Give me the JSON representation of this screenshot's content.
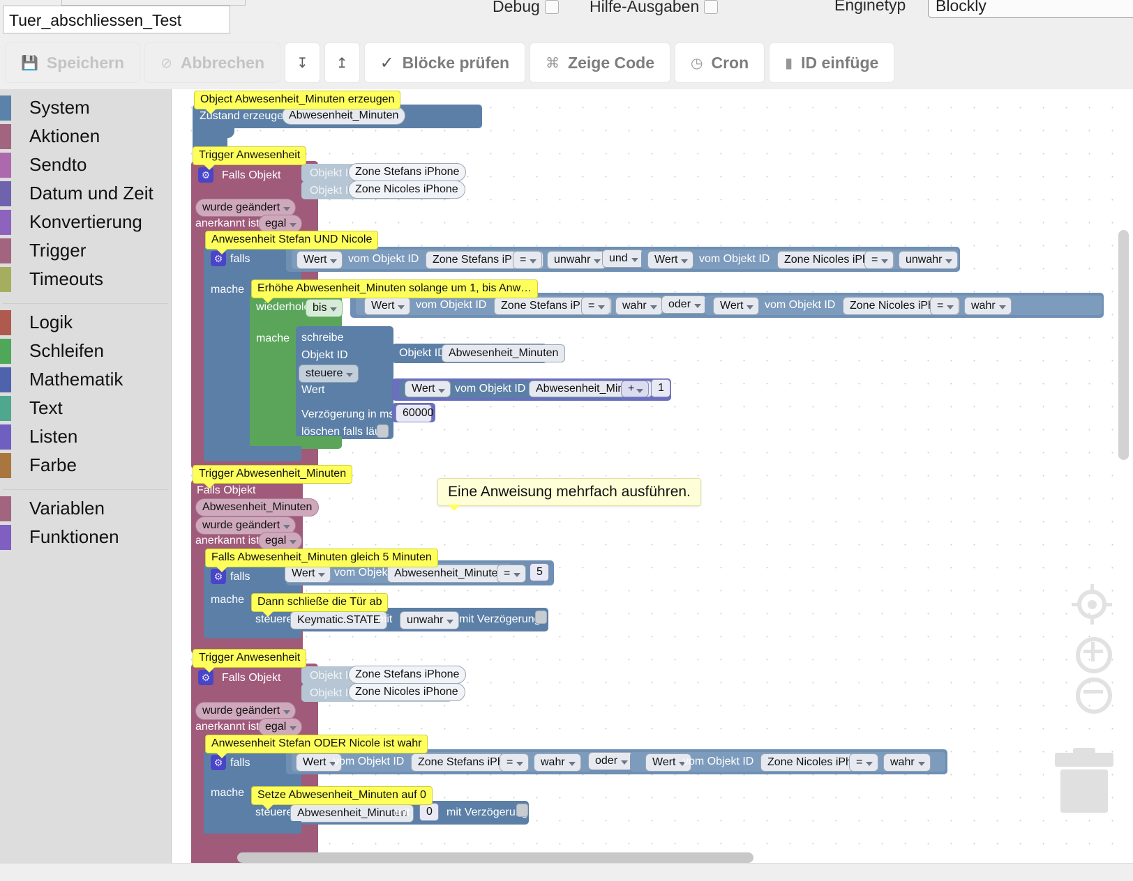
{
  "header": {
    "script_name_value": "Tuer_abschliessen_Test",
    "debug_label": "Debug",
    "hilfe_label": "Hilfe-Ausgaben",
    "enginetyp_label": "Enginetyp",
    "enginetyp_value": "Blockly"
  },
  "toolbar": {
    "save_label": "Speichern",
    "cancel_label": "Abbrechen",
    "import_icon": "download-icon",
    "export_icon": "upload-icon",
    "check_blocks_label": "Blöcke prüfen",
    "show_code_label": "Zeige Code",
    "cron_label": "Cron",
    "insert_id_label": "ID einfüge"
  },
  "sidebar": {
    "groups": [
      {
        "items": [
          {
            "label": "System",
            "color": "#5b82a8"
          },
          {
            "label": "Aktionen",
            "color": "#a2657f"
          },
          {
            "label": "Sendto",
            "color": "#ad69ad"
          },
          {
            "label": "Datum und Zeit",
            "color": "#6f63ad"
          },
          {
            "label": "Konvertierung",
            "color": "#8e63bd"
          },
          {
            "label": "Trigger",
            "color": "#a2657f"
          },
          {
            "label": "Timeouts",
            "color": "#a5ae5f"
          }
        ]
      },
      {
        "items": [
          {
            "label": "Logik",
            "color": "#b05a4f"
          },
          {
            "label": "Schleifen",
            "color": "#4fa85a"
          },
          {
            "label": "Mathematik",
            "color": "#4f63ad"
          },
          {
            "label": "Text",
            "color": "#4fa88e"
          },
          {
            "label": "Listen",
            "color": "#6f5fc0"
          },
          {
            "label": "Farbe",
            "color": "#a9763f"
          }
        ]
      },
      {
        "items": [
          {
            "label": "Variablen",
            "color": "#a2657f"
          },
          {
            "label": "Funktionen",
            "color": "#7f5fc0"
          }
        ]
      }
    ]
  },
  "workspace": {
    "tooltip": "Eine Anweisung mehrfach ausführen.",
    "comments": {
      "create_object": "Object Abwesenheit_Minuten erzeugen",
      "trigger_anwesenheit_1": "Trigger Anwesenheit",
      "and_condition": "Anwesenheit Stefan UND Nicole",
      "increase_loop": "Erhöhe Abwesenheit_Minuten solange um 1, bis Anw…",
      "trigger_minuten": "Trigger Abwesenheit_Minuten",
      "if_equals_five": "Falls Abwesenheit_Minuten gleich 5 Minuten",
      "then_lock": "Dann schließe die Tür ab",
      "trigger_anwesenheit_2": "Trigger Anwesenheit",
      "or_condition": "Anwesenheit Stefan ODER Nicole ist wahr",
      "set_zero": "Setze Abwesenheit_Minuten auf 0"
    },
    "block1": {
      "create_state_label": "Zustand erzeugen",
      "state_name": "Abwesenheit_Minuten"
    },
    "block2": {
      "falls_objekt_label": "Falls Objekt",
      "objekt_id_label": "Objekt ID",
      "object_1": "Zone Stefans iPhone",
      "object_2": "Zone Nicoles iPhone",
      "changed_label": "wurde geändert",
      "ack_label": "anerkannt ist",
      "ack_value": "egal"
    },
    "and_block": {
      "falls_label": "falls",
      "mache_label": "mache",
      "wert_label": "Wert",
      "vom_objekt_id_label": "vom Objekt ID",
      "object_1": "Zone Stefans iPhone",
      "object_2": "Zone Nicoles iPhone",
      "eq_op": "=",
      "val_1": "unwahr",
      "val_2": "unwahr",
      "join_op": "und"
    },
    "loop_block": {
      "wiederhole_label": "wiederhole",
      "bis_label": "bis",
      "mache_label": "mache",
      "wert_label": "Wert",
      "vom_objekt_id_label": "vom Objekt ID",
      "object_1": "Zone Stefans iPhone",
      "object_2": "Zone Nicoles iPhone",
      "eq_op": "=",
      "val_1": "wahr",
      "val_2": "wahr",
      "join_op": "oder"
    },
    "write_block": {
      "schreibe_label": "schreibe",
      "objekt_id_label": "Objekt ID",
      "steuere_label": "steuere",
      "wert_label": "Wert",
      "delay_label": "Verzögerung in ms",
      "clear_label": "löschen falls läuft",
      "obj_id_inner_label": "Objekt ID",
      "obj_id_value": "Abwesenheit_Minuten",
      "wert_inner_label": "Wert",
      "vom_objekt_id_label": "vom Objekt ID",
      "value_object": "Abwesenheit_Minuten",
      "plus_op": "+",
      "addend": "1",
      "delay_value": "60000"
    },
    "trigger_minuten_block": {
      "falls_objekt_label": "Falls Objekt",
      "object_name": "Abwesenheit_Minuten",
      "changed_label": "wurde geändert",
      "ack_label": "anerkannt ist",
      "ack_value": "egal"
    },
    "if_five_block": {
      "falls_label": "falls",
      "mache_label": "mache",
      "wert_label": "Wert",
      "vom_objekt_id_label": "vom Objekt ID",
      "object_name": "Abwesenheit_Minuten",
      "eq_op": "=",
      "number": "5"
    },
    "lock_block": {
      "steuere_label": "steuere",
      "target": "Keymatic.STATE",
      "mit_label": "mit",
      "value": "unwahr",
      "delay_label": "mit Verzögerung"
    },
    "trigger2_block": {
      "falls_objekt_label": "Falls Objekt",
      "objekt_id_label": "Objekt ID",
      "object_1": "Zone Stefans iPhone",
      "object_2": "Zone Nicoles iPhone",
      "changed_label": "wurde geändert",
      "ack_label": "anerkannt ist",
      "ack_value": "egal"
    },
    "or_block": {
      "falls_label": "falls",
      "mache_label": "mache",
      "wert_label": "Wert",
      "vom_objekt_id_label": "vom Objekt ID",
      "object_1": "Zone Stefans iPhone",
      "object_2": "Zone Nicoles iPhone",
      "eq_op": "=",
      "val_1": "wahr",
      "val_2": "wahr",
      "join_op": "oder"
    },
    "set_zero_block": {
      "steuere_label": "steuere",
      "target": "Abwesenheit_Minuten",
      "mit_label": "mit",
      "value": "0",
      "delay_label": "mit Verzögerung"
    },
    "controls": {
      "center_icon": "crosshair-target-icon",
      "zoom_in_icon": "plus-icon",
      "zoom_out_icon": "minus-icon",
      "trash_icon": "trash-can-icon"
    }
  }
}
